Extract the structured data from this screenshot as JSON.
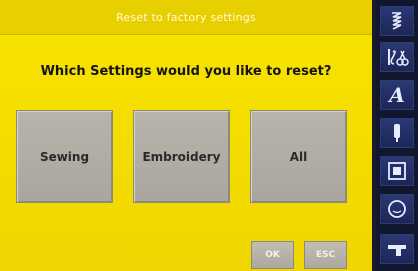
{
  "header": {
    "title": "Reset to factory settings"
  },
  "prompt": {
    "question": "Which Settings would you like to reset?"
  },
  "options": [
    {
      "label": "Sewing"
    },
    {
      "label": "Embroidery"
    },
    {
      "label": "All"
    }
  ],
  "footer": {
    "ok_label": "OK",
    "esc_label": "ESC"
  },
  "sidebar": {
    "items": [
      {
        "icon": "stitch-pattern-icon"
      },
      {
        "icon": "scissors-thread-icon"
      },
      {
        "icon": "alphabet-icon"
      },
      {
        "icon": "needle-icon"
      },
      {
        "icon": "embroidery-frame-icon"
      },
      {
        "icon": "info-face-icon"
      },
      {
        "icon": "machine-setup-icon"
      }
    ],
    "letter_label": "A"
  },
  "colors": {
    "background": "#f7e400",
    "button": "#aea99f",
    "sidebar": "#1c2658",
    "icon": "#e6ebff"
  }
}
